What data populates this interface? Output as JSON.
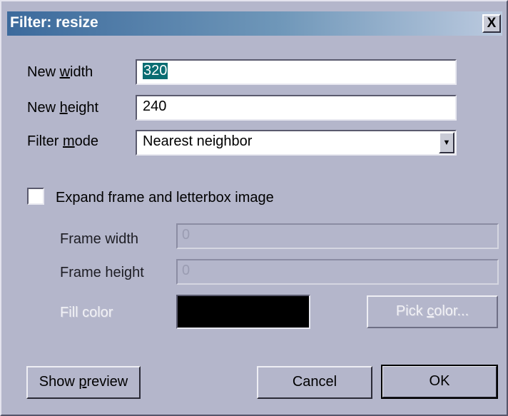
{
  "window": {
    "title": "Filter: resize",
    "close_glyph": "X"
  },
  "size": {
    "width_label_pre": "New ",
    "width_label_mn": "w",
    "width_label_post": "idth",
    "width_value": "320",
    "height_label_pre": "New ",
    "height_label_mn": "h",
    "height_label_post": "eight",
    "height_value": "240",
    "mode_label_pre": "Filter ",
    "mode_label_mn": "m",
    "mode_label_post": "ode",
    "mode_value": "Nearest neighbor"
  },
  "letterbox": {
    "checkbox_label": "Expand frame and letterbox image",
    "checked": false,
    "frame_width_label": "Frame width",
    "frame_width_value": "0",
    "frame_height_label": "Frame height",
    "frame_height_value": "0",
    "fill_color_label": "Fill color",
    "fill_color": "#000000",
    "pick_color_pre": "Pick ",
    "pick_color_mn": "c",
    "pick_color_post": "olor..."
  },
  "buttons": {
    "preview_pre": "Show ",
    "preview_mn": "p",
    "preview_post": "review",
    "cancel": "Cancel",
    "ok": "OK"
  },
  "colors": {
    "dialog_bg": "#b4b6cb",
    "title_gradient_start": "#3c6a9c",
    "title_gradient_end": "#bccadf",
    "selection": "#0a6d72"
  }
}
